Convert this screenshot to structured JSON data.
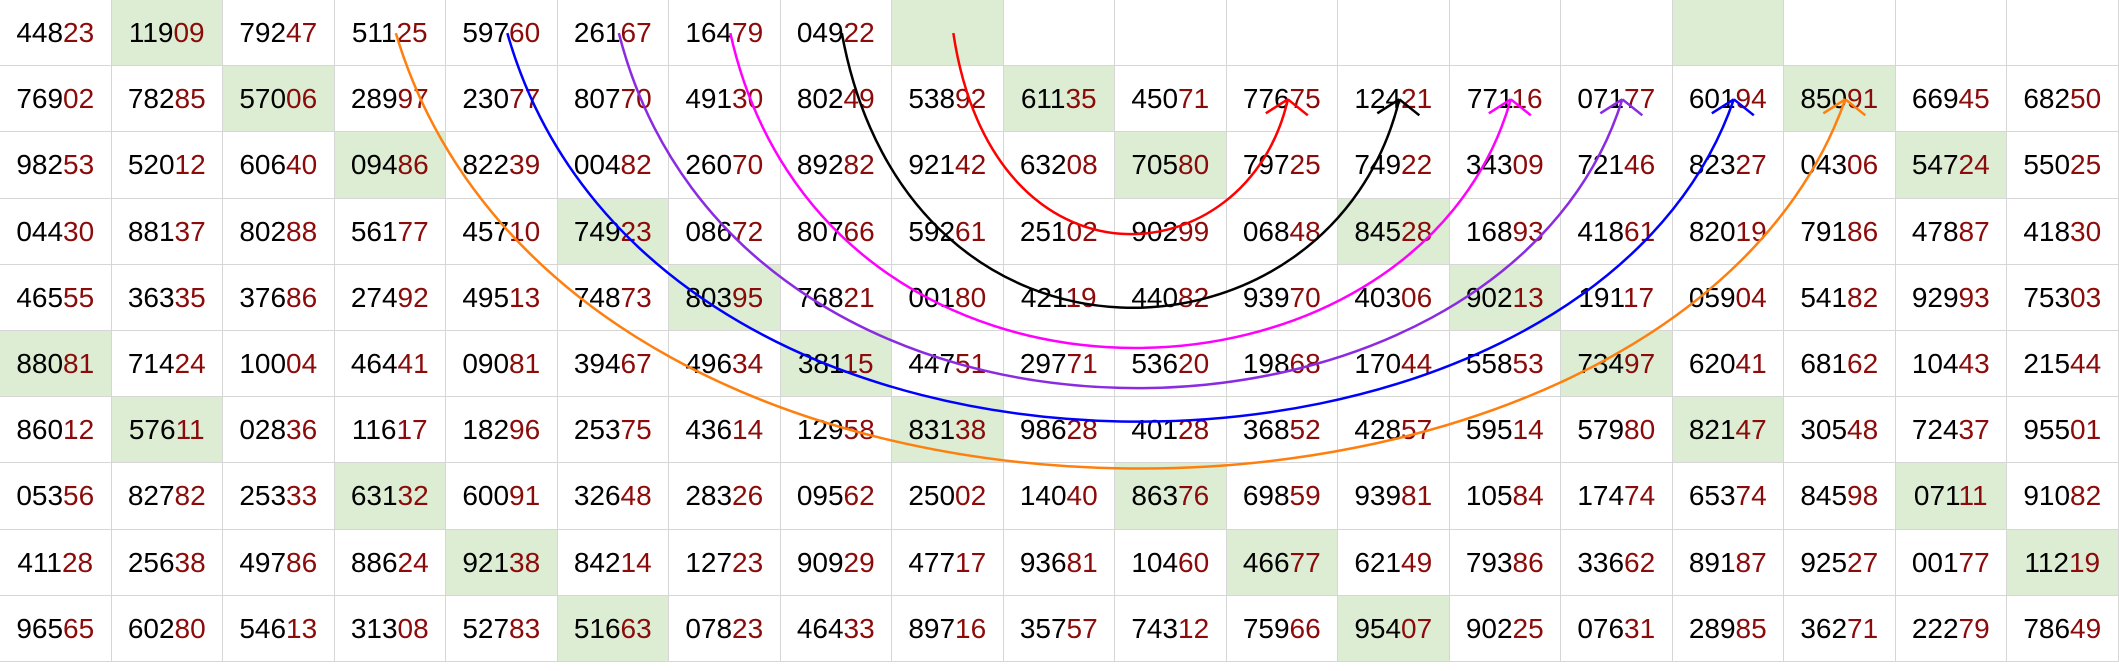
{
  "grid": {
    "rows": [
      [
        "44823",
        "11909",
        "79247",
        "51125",
        "59760",
        "26167",
        "16479",
        "04922",
        "",
        "",
        "",
        "",
        "",
        "",
        "",
        "",
        "",
        "",
        "",
        ""
      ],
      [
        "76902",
        "78285",
        "57006",
        "28997",
        "23077",
        "80770",
        "49130",
        "80249",
        "53892",
        "61135",
        "45071",
        "77675",
        "12421",
        "77116",
        "07177",
        "60194",
        "85091",
        "66945",
        "68250"
      ],
      [
        "98253",
        "52012",
        "60640",
        "09486",
        "82239",
        "00482",
        "26070",
        "89282",
        "92142",
        "63208",
        "70580",
        "79725",
        "74922",
        "34309",
        "72146",
        "82327",
        "04306",
        "54724",
        "55025"
      ],
      [
        "04430",
        "88137",
        "80288",
        "56177",
        "45710",
        "74923",
        "08672",
        "80766",
        "59261",
        "25102",
        "90299",
        "06848",
        "84528",
        "16893",
        "41861",
        "82019",
        "79186",
        "47887",
        "41830"
      ],
      [
        "46555",
        "36335",
        "37686",
        "27492",
        "49513",
        "74873",
        "80395",
        "76821",
        "00180",
        "42119",
        "44082",
        "93970",
        "40306",
        "90213",
        "19117",
        "05904",
        "54182",
        "92993",
        "75303"
      ],
      [
        "88081",
        "71424",
        "10004",
        "46441",
        "09081",
        "39467",
        "49634",
        "38115",
        "44751",
        "29771",
        "53620",
        "19868",
        "17044",
        "55853",
        "73497",
        "62041",
        "68162",
        "10443",
        "21544"
      ],
      [
        "86012",
        "57611",
        "02836",
        "11617",
        "18296",
        "25375",
        "43614",
        "12958",
        "83138",
        "98628",
        "40128",
        "36852",
        "42857",
        "59514",
        "57980",
        "82147",
        "30548",
        "72437",
        "95501"
      ],
      [
        "05356",
        "82782",
        "25333",
        "63132",
        "60091",
        "32648",
        "28326",
        "09562",
        "25002",
        "14040",
        "86376",
        "69859",
        "93981",
        "10584",
        "17474",
        "65374",
        "84598",
        "07111",
        "91082"
      ],
      [
        "41128",
        "25638",
        "49786",
        "88624",
        "92138",
        "84214",
        "12723",
        "90929",
        "47717",
        "93681",
        "10460",
        "46677",
        "62149",
        "79386",
        "33662",
        "89187",
        "92527",
        "00177",
        "11219"
      ],
      [
        "96565",
        "60280",
        "54613",
        "31308",
        "52783",
        "51663",
        "07823",
        "46433",
        "89716",
        "35757",
        "74312",
        "75966",
        "95407",
        "90225",
        "07631",
        "28985",
        "36271",
        "22279",
        "78649"
      ]
    ],
    "highlights": [
      [
        0,
        1
      ],
      [
        0,
        8
      ],
      [
        0,
        15
      ],
      [
        1,
        2
      ],
      [
        1,
        9
      ],
      [
        1,
        16
      ],
      [
        2,
        3
      ],
      [
        2,
        10
      ],
      [
        2,
        17
      ],
      [
        3,
        5
      ],
      [
        3,
        12
      ],
      [
        4,
        6
      ],
      [
        4,
        13
      ],
      [
        5,
        0
      ],
      [
        5,
        7
      ],
      [
        5,
        14
      ],
      [
        6,
        1
      ],
      [
        6,
        8
      ],
      [
        6,
        15
      ],
      [
        7,
        3
      ],
      [
        7,
        10
      ],
      [
        7,
        17
      ],
      [
        8,
        4
      ],
      [
        8,
        11
      ],
      [
        8,
        18
      ],
      [
        9,
        5
      ],
      [
        9,
        12
      ]
    ],
    "highlight_color": "#dcedd3",
    "prefix_color": "#000000",
    "suffix_color": "#8b0a0a"
  },
  "arcs": [
    {
      "color": "#ff0000",
      "from": [
        0,
        8
      ],
      "to": [
        1,
        11
      ],
      "depth_row": 3.5
    },
    {
      "color": "#000000",
      "from": [
        0,
        7
      ],
      "to": [
        1,
        12
      ],
      "depth_row": 4.6
    },
    {
      "color": "#ff00ff",
      "from": [
        0,
        6
      ],
      "to": [
        1,
        13
      ],
      "depth_row": 5.2
    },
    {
      "color": "#8a2be2",
      "from": [
        0,
        5
      ],
      "to": [
        1,
        14
      ],
      "depth_row": 5.8
    },
    {
      "color": "#0000ff",
      "from": [
        0,
        4
      ],
      "to": [
        1,
        15
      ],
      "depth_row": 6.3
    },
    {
      "color": "#ff7f0e",
      "from": [
        0,
        3
      ],
      "to": [
        1,
        16
      ],
      "depth_row": 7.0
    }
  ]
}
